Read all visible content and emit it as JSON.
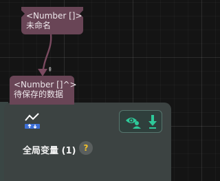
{
  "source_port": {
    "type_label": "<Number []>",
    "name": "未命名"
  },
  "connection": {
    "color": "#7a4a60",
    "toggle_mark": "⇞"
  },
  "target_port": {
    "type_label": "<Number []^>",
    "name": "待保存的数据"
  },
  "node": {
    "title": "全局变量 (1)",
    "help_glyph": "?",
    "icon": "chart-upload-icon",
    "actions": [
      {
        "icon": "user-view-icon",
        "color": "#2ec99a"
      },
      {
        "icon": "download-icon",
        "color": "#2ec99a"
      }
    ],
    "background": "#3c4342"
  }
}
